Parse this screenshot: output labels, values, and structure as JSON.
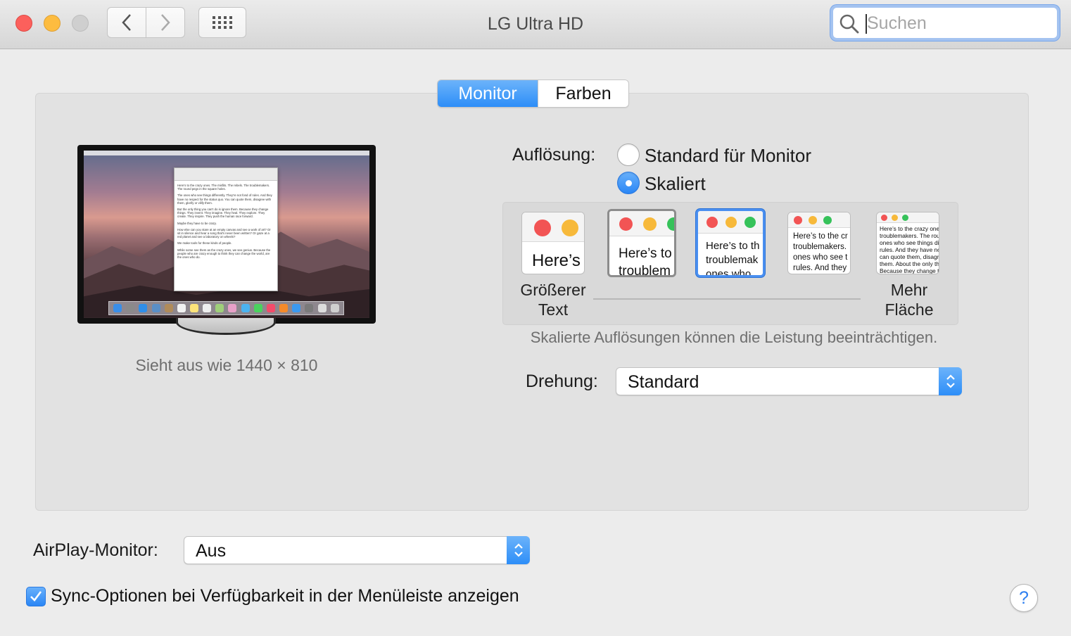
{
  "window": {
    "title": "LG Ultra HD"
  },
  "search": {
    "placeholder": "Suchen"
  },
  "tabs": [
    {
      "label": "Monitor",
      "active": true
    },
    {
      "label": "Farben",
      "active": false
    }
  ],
  "preview": {
    "looks_like": "Sieht aus wie 1440 × 810",
    "document_text": [
      "Here's to the crazy ones. The misfits. The rebels. The troublemakers. The round pegs in the square holes.",
      "The ones who see things differently. They're not fond of rules. And they have no respect for the status quo. You can quote them, disagree with them, glorify or vilify them.",
      "But the only thing you can't do is ignore them. Because they change things. They invent. They imagine. They heal. They explore. They create. They inspire. They push the human race forward.",
      "Maybe they have to be crazy.",
      "How else can you stare at an empty canvas and see a work of art? Or sit in silence and hear a song that's never been written? Or gaze at a red planet and see a laboratory on wheels?",
      "We make tools for these kinds of people.",
      "While some see them as the crazy ones, we see genius. Because the people who are crazy enough to think they can change the world, are the ones who do."
    ]
  },
  "resolution": {
    "label": "Auflösung:",
    "options": [
      {
        "label": "Standard für Monitor",
        "selected": false
      },
      {
        "label": "Skaliert",
        "selected": true
      }
    ],
    "scale_samples": [
      "Here’s",
      "Here’s to\ntroublem",
      "Here’s to th\ntroublemak\nones who",
      "Here’s to the cr\ntroublemakers.\nones who see t\nrules. And they",
      "Here’s to the crazy one\ntroublemakers. The rou\nones who see things dif\nrules. And they have no\ncan quote them, disagr\nthem. About the only th\nBecause they change t"
    ],
    "selected_index": 2,
    "left_caption": "Größerer Text",
    "right_caption": "Mehr Fläche",
    "warning": "Skalierte Auflösungen können die Leistung beeinträchtigen."
  },
  "rotation": {
    "label": "Drehung:",
    "value": "Standard"
  },
  "airplay": {
    "label": "AirPlay-Monitor:",
    "value": "Aus"
  },
  "sync_option": {
    "label": "Sync-Optionen bei Verfügbarkeit in der Menüleiste anzeigen",
    "checked": true
  },
  "help": {
    "label": "?"
  },
  "colors": {
    "accent": "#2d8ef8",
    "close": "#fc605c",
    "minimize": "#fdbc40",
    "traffic_green": "#34c84a"
  }
}
